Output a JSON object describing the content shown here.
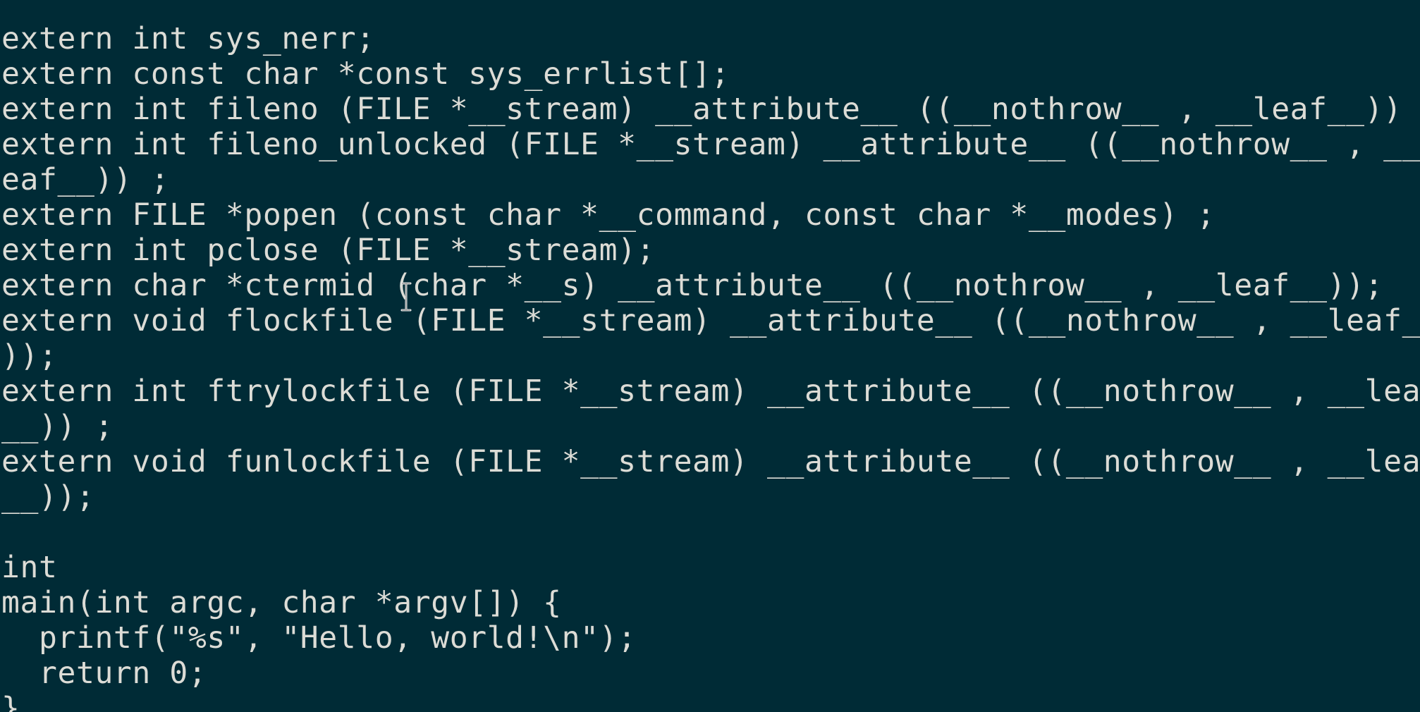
{
  "terminal": {
    "lines": [
      "extern int sys_nerr;",
      "extern const char *const sys_errlist[];",
      "extern int fileno (FILE *__stream) __attribute__ ((__nothrow__ , __leaf__)) ;",
      "extern int fileno_unlocked (FILE *__stream) __attribute__ ((__nothrow__ , __l",
      "eaf__)) ;",
      "extern FILE *popen (const char *__command, const char *__modes) ;",
      "extern int pclose (FILE *__stream);",
      "extern char *ctermid (char *__s) __attribute__ ((__nothrow__ , __leaf__));",
      "extern void flockfile (FILE *__stream) __attribute__ ((__nothrow__ , __leaf__",
      "));",
      "extern int ftrylockfile (FILE *__stream) __attribute__ ((__nothrow__ , __leaf",
      "__)) ;",
      "extern void funlockfile (FILE *__stream) __attribute__ ((__nothrow__ , __leaf",
      "__));",
      "",
      "int",
      "main(int argc, char *argv[]) {",
      "  printf(\"%s\", \"Hello, world!\\n\");",
      "  return 0;"
    ],
    "partial_last_line": "}"
  },
  "colors": {
    "background": "#002b36",
    "text": "#dcdcd6"
  },
  "icons": {
    "cursor": "i-beam-cursor-icon"
  }
}
